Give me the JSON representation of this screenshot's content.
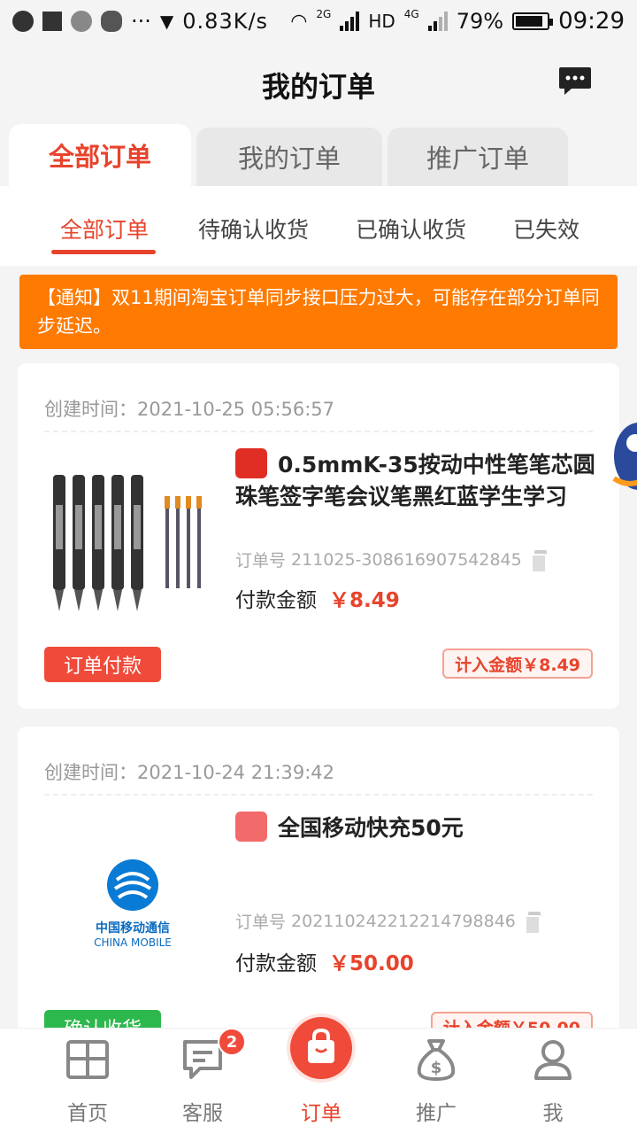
{
  "status_bar": {
    "net_speed": "0.83K/s",
    "signal1": "2G",
    "hd": "HD",
    "signal2": "4G",
    "battery": "79%",
    "time": "09:29"
  },
  "header": {
    "title": "我的订单"
  },
  "tabs": [
    {
      "label": "全部订单",
      "active": true
    },
    {
      "label": "我的订单",
      "active": false
    },
    {
      "label": "推广订单",
      "active": false
    }
  ],
  "subtabs": [
    {
      "label": "全部订单",
      "active": true
    },
    {
      "label": "待确认收货",
      "active": false
    },
    {
      "label": "已确认收货",
      "active": false
    },
    {
      "label": "已失效",
      "active": false
    }
  ],
  "notice": {
    "text": "【通知】双11期间淘宝订单同步接口压力过大，可能存在部分订单同步延迟。"
  },
  "orders": [
    {
      "time_label": "创建时间：",
      "time": "2021-10-25 05:56:57",
      "title": "0.5mmK-35按动中性笔笔芯圆珠笔签字笔会议笔黑红蓝学生学习",
      "order_label": "订单号",
      "order_no": "211025-308616907542845",
      "pay_label": "付款金额",
      "pay_amount": "￥8.49",
      "action_label": "订单付款",
      "commission": "计入金额￥8.49",
      "shop_icon": "pinduoduo-icon"
    },
    {
      "time_label": "创建时间：",
      "time": "2021-10-24 21:39:42",
      "title": "全国移动快充50元",
      "order_label": "订单号",
      "order_no": "20211024221221479​8846",
      "pay_label": "付款金额",
      "pay_amount": "￥50.00",
      "action_label": "确认收货",
      "commission": "计入金额￥50.00",
      "shop_icon": "phone-recharge-icon",
      "logo_cn": "中国移动通信",
      "logo_en": "CHINA MOBILE"
    }
  ],
  "bottom_nav": [
    {
      "label": "首页",
      "icon": "home-grid-icon"
    },
    {
      "label": "客服",
      "icon": "chat-icon",
      "badge": "2"
    },
    {
      "label": "订单",
      "icon": "shopping-bag-icon",
      "active": true
    },
    {
      "label": "推广",
      "icon": "money-bag-icon"
    },
    {
      "label": "我",
      "icon": "user-icon"
    }
  ],
  "colors": {
    "accent": "#e8432c",
    "notice": "#ff7a00",
    "confirm": "#2db84d"
  }
}
